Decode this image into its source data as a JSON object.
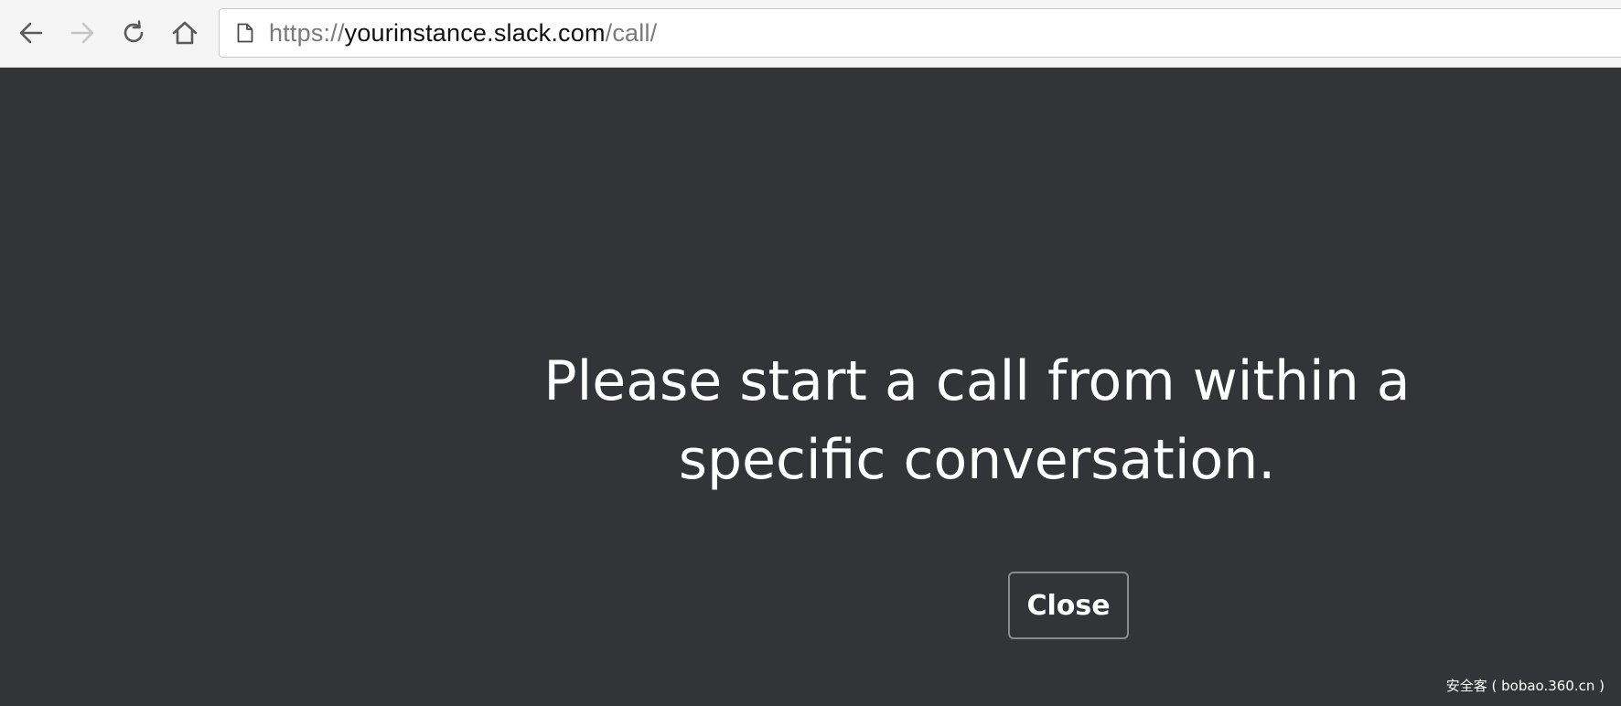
{
  "browser": {
    "back_icon": "arrow-left-icon",
    "forward_icon": "arrow-right-icon",
    "reload_icon": "reload-icon",
    "home_icon": "home-icon",
    "page_icon": "page-icon",
    "url": {
      "scheme": "https://",
      "host": "yourinstance.slack.com",
      "path": "/call/"
    }
  },
  "main": {
    "message": "Please start a call from within a specific conversation.",
    "close_label": "Close"
  },
  "watermark": "安全客 ( bobao.360.cn )",
  "colors": {
    "background": "#333437",
    "text": "#ffffff",
    "button_border": "#8a8a8d",
    "toolbar": "#f5f5f5"
  }
}
